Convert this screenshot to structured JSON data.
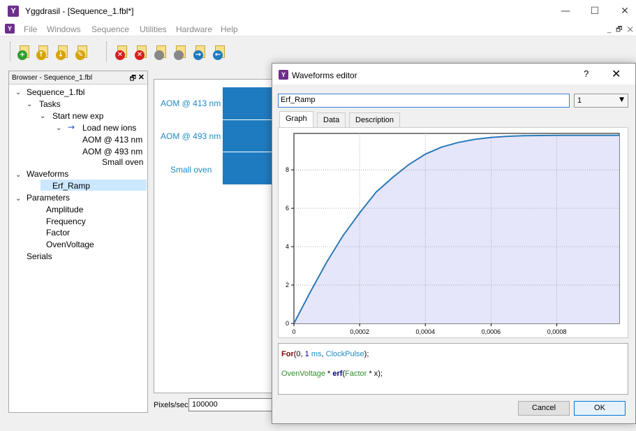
{
  "window": {
    "title": "Yggdrasil - [Sequence_1.fbl*]",
    "icon": "yggdrasil-app-icon",
    "controls": {
      "minimize": "—",
      "maximize": "☐",
      "close": "✕"
    }
  },
  "menubar": {
    "items": [
      "File",
      "Windows",
      "Sequence",
      "Utilities",
      "Hardware",
      "Help"
    ],
    "mdi_controls": "_ 🗗 ✕"
  },
  "toolbar": {
    "buttons": [
      {
        "name": "new-task-icon",
        "badge": "+",
        "color": "#2e9e2e"
      },
      {
        "name": "open-task-icon",
        "badge": "↑",
        "color": "#d6a300"
      },
      {
        "name": "save-down-icon",
        "badge": "↓",
        "color": "#d6a300"
      },
      {
        "name": "edit-task-icon",
        "badge": "✎",
        "color": "#d6a300"
      },
      {
        "name": "remove-task-icon",
        "badge": "✕",
        "color": "#d62020"
      },
      {
        "name": "remove-all-icon",
        "badge": "✕",
        "color": "#d62020"
      },
      {
        "name": "copy-icon",
        "badge": "",
        "color": "#888888"
      },
      {
        "name": "paste-icon",
        "badge": "",
        "color": "#888888"
      },
      {
        "name": "forward-icon",
        "badge": "→",
        "color": "#1f7bbf"
      },
      {
        "name": "back-icon",
        "badge": "←",
        "color": "#1f7bbf"
      }
    ]
  },
  "browser": {
    "title": "Browser - Sequence_1.fbl",
    "float_icon": "🗗",
    "close_icon": "✕",
    "tree": [
      {
        "label": "Sequence_1.fbl",
        "expanded": true
      },
      {
        "label": "Tasks",
        "expanded": true
      },
      {
        "label": "Start new exp",
        "expanded": true
      },
      {
        "label": "Load new ions",
        "expanded": true,
        "arrow": "→"
      },
      {
        "label": "AOM @ 413 nm"
      },
      {
        "label": "AOM @ 493 nm"
      },
      {
        "label": "Small oven"
      },
      {
        "label": "Waveforms",
        "expanded": true
      },
      {
        "label": "Erf_Ramp",
        "selected": true
      },
      {
        "label": "Parameters",
        "expanded": true
      },
      {
        "label": "Amplitude"
      },
      {
        "label": "Frequency"
      },
      {
        "label": "Factor"
      },
      {
        "label": "OvenVoltage"
      },
      {
        "label": "Serials"
      }
    ]
  },
  "sequence": {
    "tracks": [
      "AOM @ 413 nm",
      "AOM @ 493 nm",
      "Small oven"
    ],
    "track_color": "#1f7bbf",
    "pixels_label": "Pixels/sec",
    "pixels_value": "100000"
  },
  "dialog": {
    "title": "Waveforms editor",
    "help": "?",
    "close": "✕",
    "name_value": "Erf_Ramp",
    "channel_value": "1",
    "tabs": [
      "Graph",
      "Data",
      "Description"
    ],
    "active_tab": "Graph",
    "code": {
      "line1": {
        "kw": "For",
        "open": "(0, ",
        "num": "1",
        "unit": " ms",
        "sep": ", ",
        "var": "ClockPulse",
        "close": ");"
      },
      "line2": {
        "param1": "OvenVoltage",
        "op1": " * ",
        "fn": "erf",
        "open": "(",
        "param2": "Factor",
        "op2": " * x);"
      }
    },
    "cancel_label": "Cancel",
    "ok_label": "OK"
  },
  "chart_data": {
    "type": "area",
    "title": "",
    "xlabel": "",
    "ylabel": "",
    "xlim": [
      0,
      0.00099
    ],
    "ylim": [
      0,
      9.9
    ],
    "x_ticks": [
      "0",
      "0,0002",
      "0,0004",
      "0,0006",
      "0,0008"
    ],
    "y_ticks": [
      "0",
      "2",
      "4",
      "6",
      "8"
    ],
    "grid": true,
    "line_color": "#2a7ab8",
    "fill_color": "#e6e6fa",
    "series": [
      {
        "x": [
          0,
          5e-05,
          0.0001,
          0.00015,
          0.0002,
          0.00025,
          0.0003,
          0.00035,
          0.0004,
          0.00045,
          0.0005,
          0.00055,
          0.0006,
          0.00065,
          0.0007,
          0.00075,
          0.0008,
          0.00085,
          0.0009,
          0.00095,
          0.00099
        ],
        "values": [
          0,
          1.64,
          3.2,
          4.59,
          5.76,
          6.84,
          7.6,
          8.28,
          8.82,
          9.19,
          9.43,
          9.59,
          9.69,
          9.75,
          9.78,
          9.79,
          9.8,
          9.8,
          9.8,
          9.8,
          9.8
        ]
      }
    ]
  }
}
